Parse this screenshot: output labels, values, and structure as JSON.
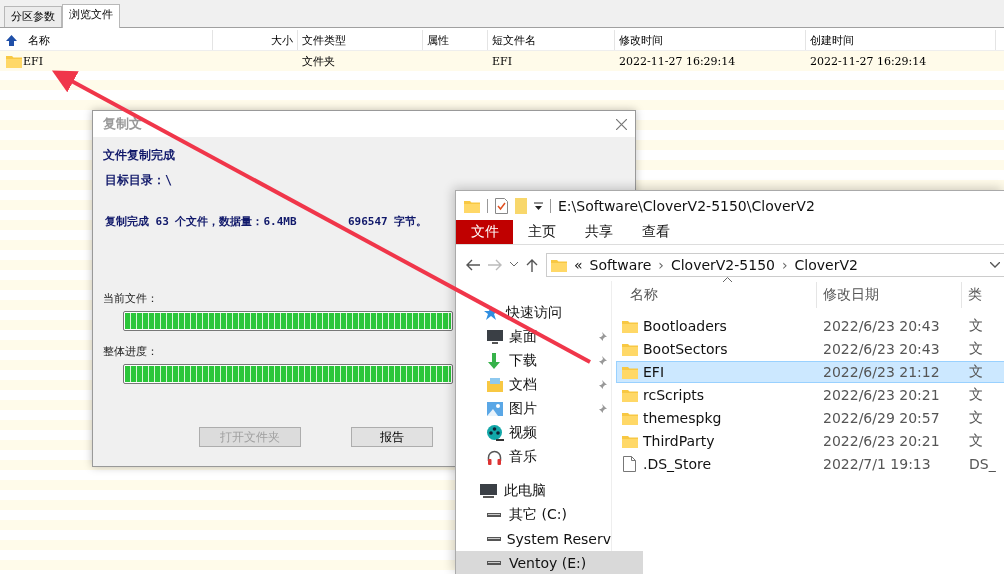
{
  "main_window": {
    "tabs": [
      {
        "label": "分区参数",
        "selected": false
      },
      {
        "label": "浏览文件",
        "selected": true
      }
    ],
    "columns": [
      "名称",
      "大小",
      "文件类型",
      "属性",
      "短文件名",
      "修改时间",
      "创建时间"
    ],
    "rows": [
      {
        "name": "EFI",
        "type": "文件夹",
        "short_name": "EFI",
        "modified": "2022-11-27 16:29:14",
        "created": "2022-11-27 16:29:14"
      }
    ]
  },
  "dialog": {
    "title": "复制文",
    "heading": "文件复制完成",
    "target": "目标目录：\\",
    "summary_parts": [
      "复制完成 63 个文件，数据量：6.4MB",
      "696547 字节。"
    ],
    "progress": [
      {
        "label": "当前文件：",
        "level": 1
      },
      {
        "label": "整体进度：",
        "level": 1
      }
    ],
    "buttons": [
      {
        "label": "打开文件夹",
        "disabled": true
      },
      {
        "label": "报告",
        "disabled": false
      }
    ]
  },
  "explorer": {
    "title_path": "E:\\Software\\CloverV2-5150\\CloverV2",
    "ribbon_tabs": [
      {
        "label": "文件",
        "selected": true
      },
      {
        "label": "主页",
        "selected": false
      },
      {
        "label": "共享",
        "selected": false
      },
      {
        "label": "查看",
        "selected": false
      }
    ],
    "breadcrumb": [
      {
        "kind": "overflow",
        "text": "«"
      },
      {
        "kind": "crumb",
        "text": "Software"
      },
      {
        "kind": "separator",
        "text": "›"
      },
      {
        "kind": "crumb",
        "text": "CloverV2-5150"
      },
      {
        "kind": "separator",
        "text": "›"
      },
      {
        "kind": "crumb",
        "text": "CloverV2"
      }
    ],
    "nav": [
      {
        "label": "快速访问",
        "kind": "star",
        "selected": false,
        "children": [
          {
            "label": "桌面",
            "kind": "desktop",
            "pinned": true,
            "selected": false
          },
          {
            "label": "下载",
            "kind": "download",
            "pinned": true,
            "selected": false
          },
          {
            "label": "文档",
            "kind": "documents",
            "pinned": true,
            "selected": false
          },
          {
            "label": "图片",
            "kind": "pictures",
            "pinned": true,
            "selected": false
          },
          {
            "label": "视频",
            "kind": "video",
            "pinned": false,
            "selected": false
          },
          {
            "label": "音乐",
            "kind": "music",
            "pinned": false,
            "selected": false
          }
        ]
      },
      {
        "label": "此电脑",
        "kind": "pc",
        "selected": false,
        "children": [
          {
            "label": "其它 (C:)",
            "kind": "drive",
            "pinned": false,
            "selected": false
          },
          {
            "label": "System Reserv",
            "kind": "drive",
            "pinned": false,
            "selected": false
          },
          {
            "label": "Ventoy (E:)",
            "kind": "drive",
            "pinned": false,
            "selected": true
          }
        ]
      }
    ],
    "columns": [
      "名称",
      "修改日期",
      "类"
    ],
    "files": [
      {
        "name": "Bootloaders",
        "kind": "folder",
        "modified": "2022/6/23 20:43",
        "type": "文",
        "selected": false
      },
      {
        "name": "BootSectors",
        "kind": "folder",
        "modified": "2022/6/23 20:43",
        "type": "文",
        "selected": false
      },
      {
        "name": "EFI",
        "kind": "folder",
        "modified": "2022/6/23 21:12",
        "type": "文",
        "selected": true
      },
      {
        "name": "rcScripts",
        "kind": "folder",
        "modified": "2022/6/23 20:21",
        "type": "文",
        "selected": false
      },
      {
        "name": "themespkg",
        "kind": "folder",
        "modified": "2022/6/29 20:57",
        "type": "文",
        "selected": false
      },
      {
        "name": "ThirdParty",
        "kind": "folder",
        "modified": "2022/6/23 20:21",
        "type": "文",
        "selected": false
      },
      {
        "name": ".DS_Store",
        "kind": "file",
        "modified": "2022/7/1 19:13",
        "type": "DS_",
        "selected": false
      }
    ]
  }
}
